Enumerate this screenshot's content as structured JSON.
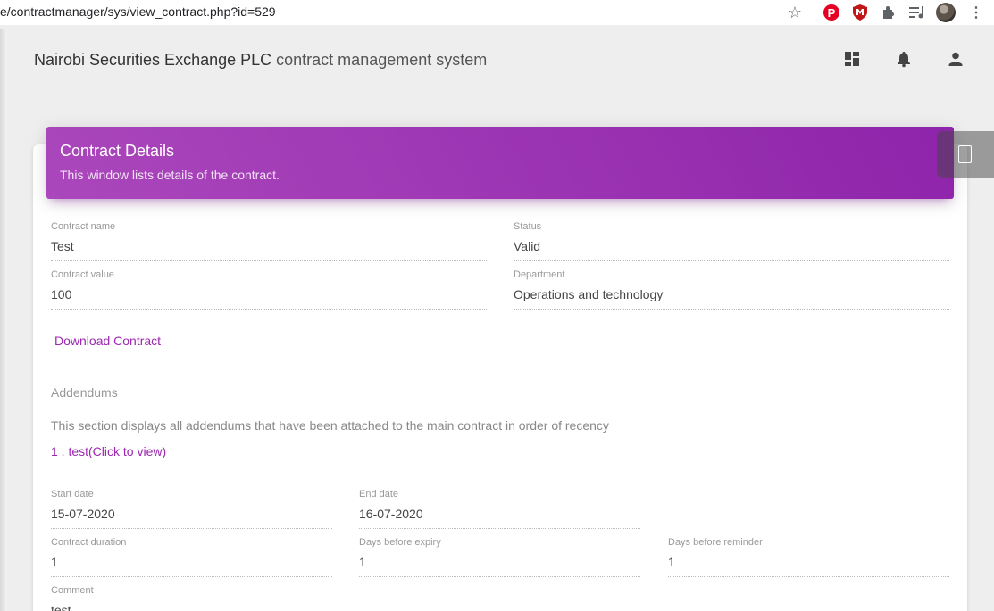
{
  "browser": {
    "url": "e/contractmanager/sys/view_contract.php?id=529",
    "star_glyph": "☆",
    "pin_glyph": "P",
    "menu_glyph": "⋮"
  },
  "header": {
    "company": "Nairobi Securities Exchange PLC",
    "system": "contract management system"
  },
  "card": {
    "title": "Contract Details",
    "subtitle": "This window lists details of the contract."
  },
  "fields": {
    "contract_name": {
      "label": "Contract name",
      "value": "Test"
    },
    "status": {
      "label": "Status",
      "value": "Valid"
    },
    "contract_value": {
      "label": "Contract value",
      "value": "100"
    },
    "department": {
      "label": "Department",
      "value": "Operations and technology"
    },
    "start_date": {
      "label": "Start date",
      "value": "15-07-2020"
    },
    "end_date": {
      "label": "End date",
      "value": "16-07-2020"
    },
    "duration": {
      "label": "Contract duration",
      "value": "1"
    },
    "days_before_expiry": {
      "label": "Days before expiry",
      "value": "1"
    },
    "days_before_reminder": {
      "label": "Days before reminder",
      "value": "1"
    },
    "comment": {
      "label": "Comment",
      "value": "test"
    }
  },
  "download_link": "Download Contract",
  "addendums": {
    "title": "Addendums",
    "description": "This section displays all addendums that have been attached to the main contract in order of recency",
    "items": [
      "1 . test(Click to view)"
    ]
  },
  "colors": {
    "accent": "#9c27b0",
    "header_gradient_start": "#ab47bc",
    "header_gradient_end": "#8e24aa"
  },
  "icons": [
    "star-icon",
    "pinterest-icon",
    "shield-icon",
    "puzzle-icon",
    "media-icon",
    "avatar",
    "menu-icon",
    "dashboard-icon",
    "bell-icon",
    "person-icon"
  ]
}
